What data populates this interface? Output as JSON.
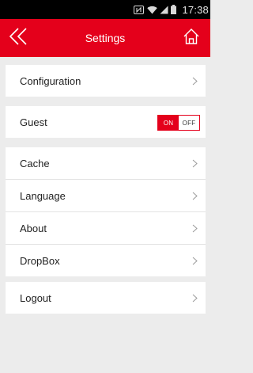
{
  "status_bar": {
    "time": "17:38",
    "icons": [
      "nfc-icon",
      "wifi-icon",
      "signal-icon",
      "battery-icon"
    ]
  },
  "header": {
    "title": "Settings",
    "back_icon": "double-chevron-left-icon",
    "home_icon": "home-icon"
  },
  "groups": [
    {
      "items": [
        {
          "label": "Configuration",
          "control": "chevron"
        }
      ]
    },
    {
      "items": [
        {
          "label": "Guest",
          "control": "toggle",
          "on_label": "ON",
          "off_label": "OFF",
          "value": "ON"
        }
      ]
    },
    {
      "items": [
        {
          "label": "Cache",
          "control": "chevron"
        },
        {
          "label": "Language",
          "control": "chevron"
        },
        {
          "label": "About",
          "control": "chevron"
        },
        {
          "label": "DropBox",
          "control": "chevron"
        }
      ]
    },
    {
      "items": [
        {
          "label": "Logout",
          "control": "chevron"
        }
      ]
    }
  ],
  "colors": {
    "accent": "#e4001b",
    "background": "#ececec",
    "card": "#ffffff",
    "chevron": "#9a9a9a"
  }
}
